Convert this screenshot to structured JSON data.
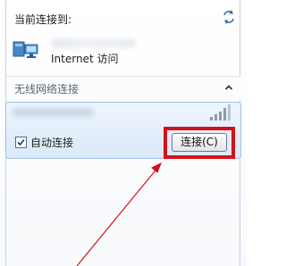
{
  "header": {
    "title": "当前连接到:",
    "refresh_icon": "refresh-icon"
  },
  "current_connection": {
    "icon": "network-icon",
    "access_label": "Internet 访问"
  },
  "wireless_section": {
    "label": "无线网络连接",
    "collapse_icon": "chevron-up-icon"
  },
  "wifi_item": {
    "signal_icon": "signal-strength-icon",
    "auto_connect_label": "自动连接",
    "auto_connect_checked": true,
    "connect_label": "连接(C)"
  },
  "annotation": {
    "highlight_color": "#d4111a"
  }
}
